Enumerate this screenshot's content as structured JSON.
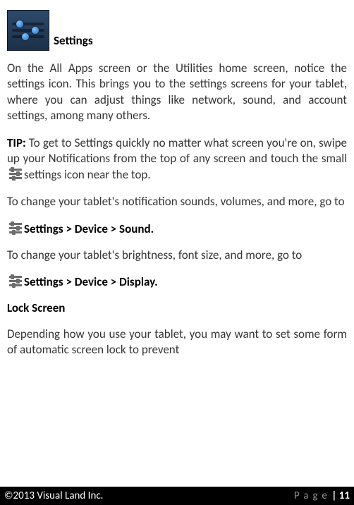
{
  "header": {
    "title": "Settings"
  },
  "paragraphs": {
    "intro": "On the All Apps screen or the Utilities home screen, notice the settings icon. This brings you to the settings screens for your tablet, where you can adjust things like network, sound, and account settings, among many others.",
    "tip_label": "TIP:",
    "tip_part1": " To get to Settings quickly no matter what screen you're on, swipe up your Notifications from the top of any screen and touch the small ",
    "tip_part2": "settings icon near the top.",
    "sound_lead": "To change your tablet's notification sounds, volumes, and more, go to",
    "display_lead": "To change your tablet's brightness, font size, and more, go to",
    "lock_body": "Depending how you use your tablet, you may want to set some form of automatic screen lock to prevent"
  },
  "paths": {
    "sound": "Settings > Device > Sound",
    "display": "Settings > Device > Display"
  },
  "sections": {
    "lock": "Lock Screen"
  },
  "footer": {
    "copyright": "©2013 Visual Land Inc.",
    "page_label": "Page",
    "page_number": "11"
  }
}
